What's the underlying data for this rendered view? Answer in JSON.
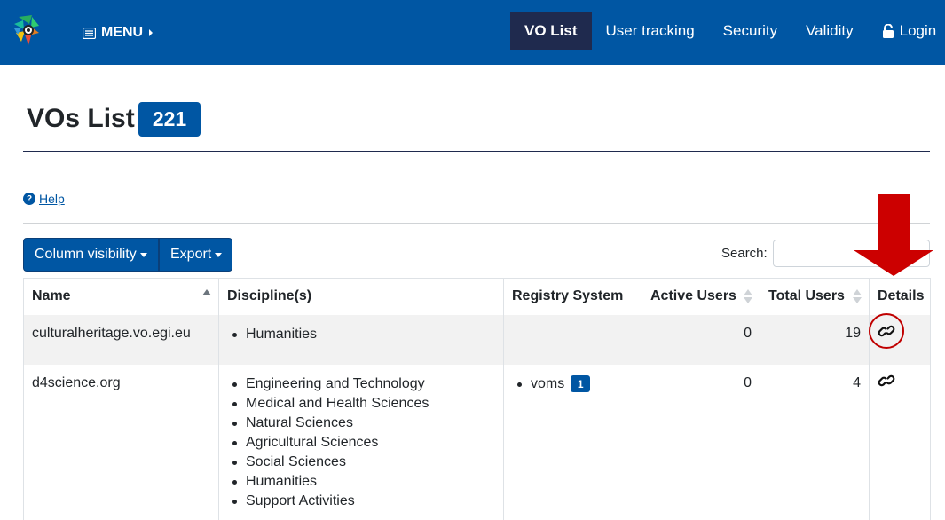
{
  "navbar": {
    "menu_label": "MENU",
    "items": [
      {
        "label": "VO List",
        "active": true
      },
      {
        "label": "User tracking"
      },
      {
        "label": "Security"
      },
      {
        "label": "Validity"
      },
      {
        "label": "Login",
        "icon": "lock-icon"
      }
    ]
  },
  "header": {
    "title": "VOs List",
    "count": "221"
  },
  "help": {
    "label": " Help"
  },
  "controls": {
    "column_visibility": "Column visibility",
    "export": "Export",
    "search_label": "Search:",
    "search_value": ""
  },
  "table": {
    "columns": [
      "Name",
      "Discipline(s)",
      "Registry System",
      "Active Users",
      "Total Users",
      "Details"
    ],
    "rows": [
      {
        "name": "culturalheritage.vo.egi.eu",
        "disciplines": [
          "Humanities"
        ],
        "registry": [],
        "active_users": "0",
        "total_users": "19",
        "details_icon": "link-icon"
      },
      {
        "name": "d4science.org",
        "disciplines": [
          "Engineering and Technology",
          "Medical and Health Sciences",
          "Natural Sciences",
          "Agricultural Sciences",
          "Social Sciences",
          "Humanities",
          "Support Activities"
        ],
        "registry": [
          {
            "label": "voms",
            "badge": "1"
          }
        ],
        "active_users": "0",
        "total_users": "4",
        "details_icon": "link-icon"
      }
    ]
  },
  "colors": {
    "primary": "#0056a3",
    "navbar_active": "#1f2a4e",
    "annotation_red": "#c00000"
  }
}
